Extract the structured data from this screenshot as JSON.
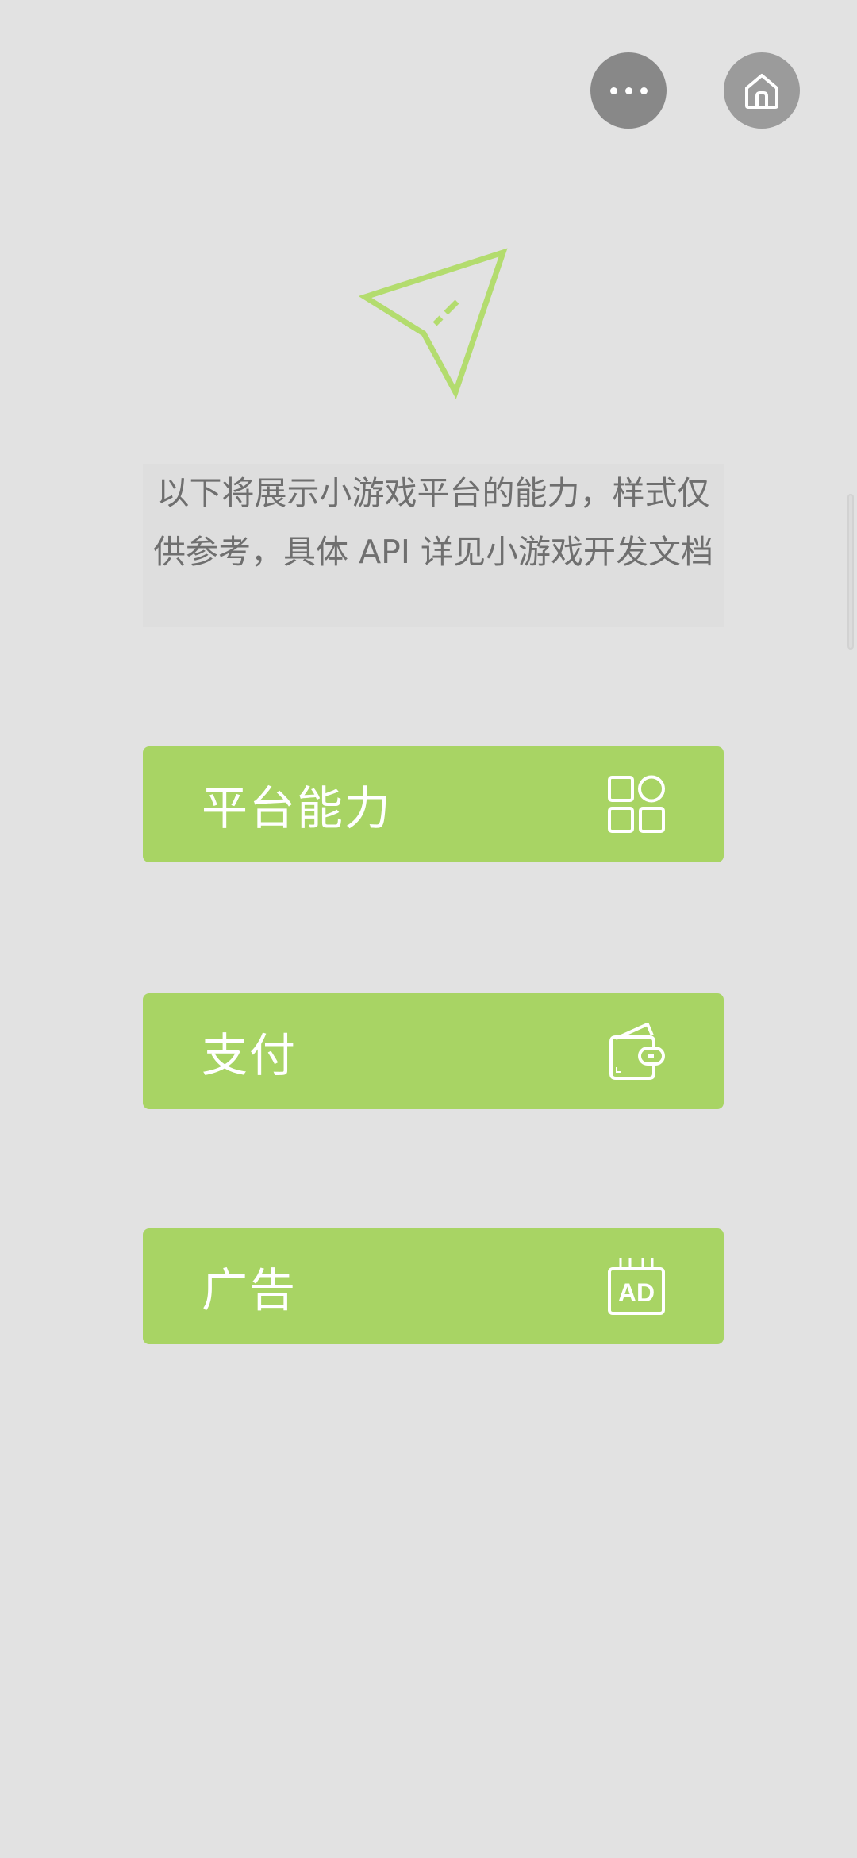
{
  "capsule": {
    "more_icon": "more-dots-icon",
    "home_icon": "home-icon"
  },
  "logo": {
    "icon": "paper-plane-icon",
    "color": "#b3dc6e"
  },
  "intro_text": "以下将展示小游戏平台的能力，样式仅供参考，具体 API 详见小游戏开发文档",
  "menu": [
    {
      "label": "平台能力",
      "icon": "grid-apps-icon"
    },
    {
      "label": "支付",
      "icon": "wallet-icon"
    },
    {
      "label": "广告",
      "icon": "ad-icon"
    }
  ],
  "colors": {
    "background": "#e2e2e2",
    "button": "#a8d464",
    "text": "#6f6f6f"
  }
}
